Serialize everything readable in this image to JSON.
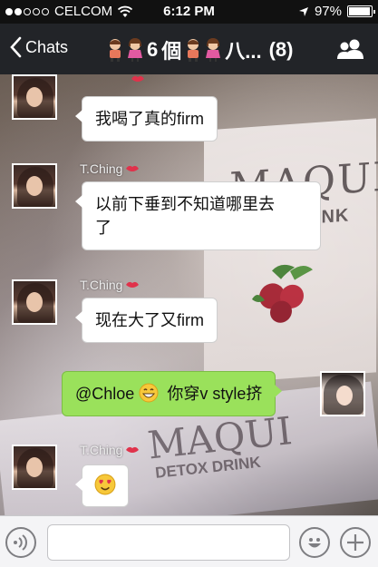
{
  "status_bar": {
    "carrier": "CELCOM",
    "time": "6:12 PM",
    "battery": "97%",
    "battery_level": 0.97
  },
  "nav": {
    "back_label": "Chats",
    "title_number": "6",
    "title_char": "個",
    "title_tail": "八...",
    "member_count": "(8)"
  },
  "messages": [
    {
      "sender": "",
      "text": "我喝了真的firm"
    },
    {
      "sender": "T.Ching",
      "text_line1": "以前下垂到不知道哪里去",
      "text_line2": "了"
    },
    {
      "sender": "T.Ching",
      "text": "现在大了又firm"
    },
    {
      "sender": "self",
      "mention": "@Chloe",
      "text": "你穿v style挤"
    },
    {
      "sender": "T.Ching",
      "emoji": "smiling-heart-eyes-emoji"
    }
  ],
  "background": {
    "box_brand": "MAQUI",
    "box_sub": "DRINK",
    "packet_brand": "MAQUI",
    "packet_sub": "DETOX DRINK"
  },
  "icons": {
    "voice": "voice-icon",
    "emoji_picker": "smiley-icon",
    "add": "plus-icon",
    "contacts": "contacts-icon"
  },
  "colors": {
    "outgoing_bubble": "#9ae15b",
    "incoming_bubble": "#ffffff",
    "nav_background": "#222428"
  }
}
